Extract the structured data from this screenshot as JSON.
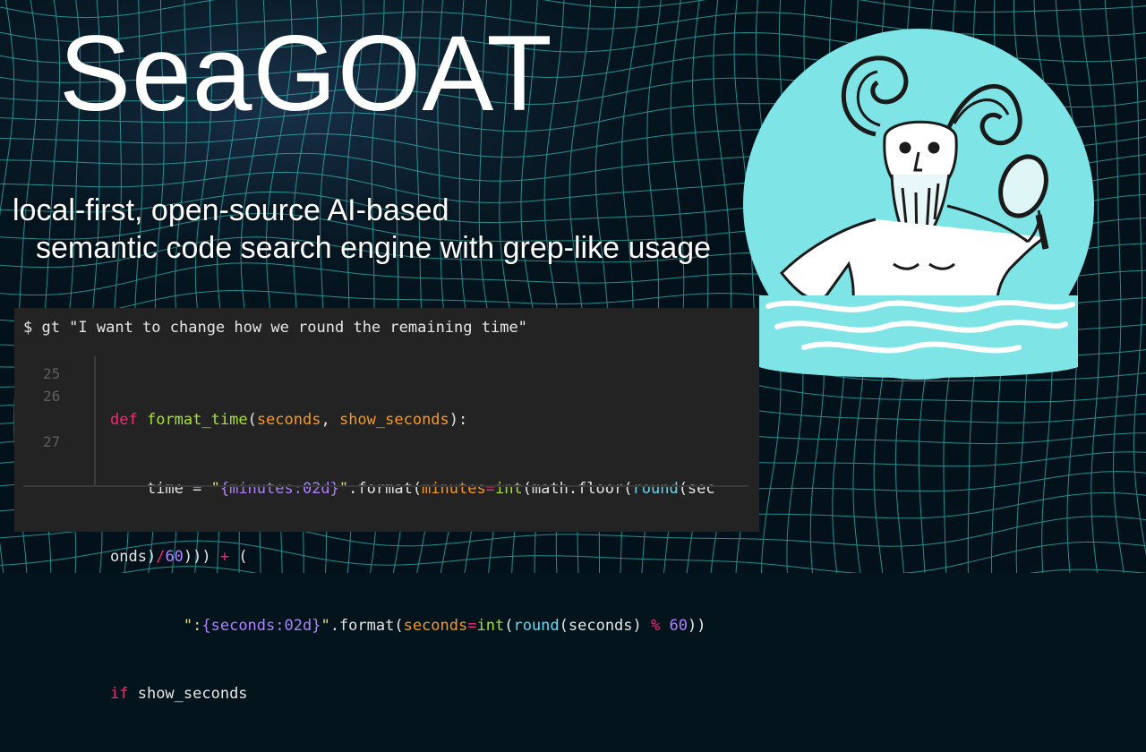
{
  "title": "SeaGOAT",
  "tagline": {
    "line1": "local-first, open-source AI-based",
    "line2": "semantic code search engine with grep-like usage"
  },
  "logo": {
    "icon": "goat-man-with-magnifying-glass-icon",
    "bg_color": "#7ee4e6"
  },
  "colors": {
    "grid": "#2fb7b3",
    "terminal_bg": "#232323"
  },
  "terminal": {
    "command": "$ gt \"I want to change how we round the remaining time\"",
    "line_numbers": [
      "25",
      "26",
      "27"
    ],
    "code": {
      "l25": {
        "kw": "def",
        "fn": "format_time",
        "p1": "(",
        "a1": "seconds",
        "sep": ", ",
        "a2": "show_seconds",
        "end": "):"
      },
      "l26a": {
        "indent": "    time = ",
        "q1": "\"",
        "ph": "{minutes:02d}",
        "q2": "\"",
        "fmt": ".format(",
        "kwarg": "minutes",
        "eq": "=",
        "int": "int",
        "call": "(math.floor(",
        "round": "round",
        "rest": "(sec"
      },
      "l26b": {
        "pre": "onds)",
        "div": "/",
        "num": "60",
        "post": "))) ",
        "plus": "+",
        "tail": " ("
      },
      "l27": {
        "indent": "        ",
        "q1": "\":",
        "ph": "{seconds:02d}",
        "q2": "\"",
        "fmt": ".format(",
        "kwarg": "seconds",
        "eq": "=",
        "int": "int",
        "p": "(",
        "round": "round",
        "arg": "(seconds) ",
        "mod": "%",
        "sp": " ",
        "num": "60",
        "end": "))"
      },
      "l28": {
        "kw": "if",
        "rest": " show_seconds"
      }
    }
  }
}
